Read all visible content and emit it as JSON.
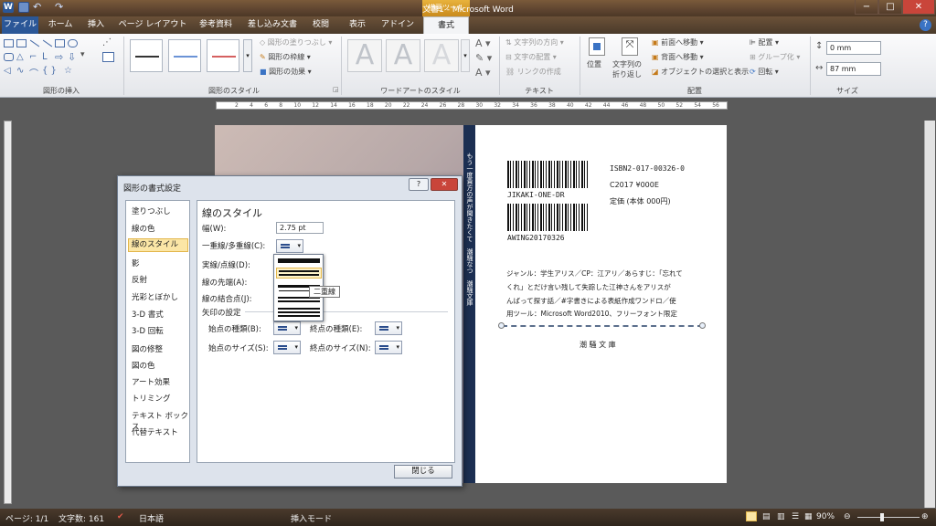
{
  "titlebar": {
    "title": "文書1 - Microsoft Word",
    "context_group": "描画ツール",
    "buttons": [
      "−",
      "□",
      "✕"
    ]
  },
  "tabs": [
    {
      "label": "ファイル"
    },
    {
      "label": "ホーム"
    },
    {
      "label": "挿入"
    },
    {
      "label": "ページ レイアウト"
    },
    {
      "label": "参考資料"
    },
    {
      "label": "差し込み文書"
    },
    {
      "label": "校閲"
    },
    {
      "label": "表示"
    },
    {
      "label": "アドイン"
    },
    {
      "label": "書式"
    }
  ],
  "ribbon": {
    "groups": {
      "insert_shapes": "図形の挿入",
      "shape_styles": "図形のスタイル",
      "wordart_styles": "ワードアートのスタイル",
      "text": "テキスト",
      "arrange": "配置",
      "size": "サイズ"
    },
    "shape_fill": "図形の塗りつぶし",
    "shape_outline": "図形の枠線",
    "shape_effects": "図形の効果",
    "text_direction": "文字列の方向",
    "text_align": "文字の配置",
    "create_link": "リンクの作成",
    "position": "位置",
    "wrap_text_1": "文字列の",
    "wrap_text_2": "折り返し",
    "bring_forward": "前面へ移動",
    "send_backward": "背面へ移動",
    "selection_pane": "オブジェクトの選択と表示",
    "align": "配置",
    "group": "グループ化",
    "rotate": "回転",
    "height": "0 mm",
    "width": "87 mm"
  },
  "ruler_ticks": [
    "2",
    "4",
    "6",
    "8",
    "10",
    "12",
    "14",
    "16",
    "18",
    "20",
    "22",
    "24",
    "26",
    "28",
    "30",
    "32",
    "34",
    "36",
    "38",
    "40",
    "42",
    "44",
    "46",
    "48",
    "50",
    "52",
    "54",
    "56"
  ],
  "document": {
    "isbn": "ISBN2-017-00326-0",
    "price_code": "C2017 ¥000E",
    "price": "定価 (本体 000円)",
    "barcode1_text": "JIKAKI-ONE-DR",
    "barcode2_text": "AWING20170326",
    "desc_line1": "ジャンル：学生アリス／CP：江アリ／あらすじ：「忘れて",
    "desc_line2": "くれ」とだけ言い残して失踪した江神さんをアリスが",
    "desc_line3": "んばって探す話／#字書きによる表紙作成ワンドロ／使",
    "desc_line4": "用ツール：Microsoft Word2010、フリーフォント限定",
    "publisher": "潮 騒 文 庫",
    "spine_text_1": "もう一度貴方の声が聞きたくて",
    "spine_text_2": "潮騒なつ",
    "spine_text_3": "潮騒文庫"
  },
  "dialog": {
    "title": "図形の書式設定",
    "nav": [
      "塗りつぶし",
      "線の色",
      "線のスタイル",
      "影",
      "反射",
      "光彩とぼかし",
      "3-D 書式",
      "3-D 回転",
      "図の修整",
      "図の色",
      "アート効果",
      "トリミング",
      "テキスト ボックス",
      "代替テキスト"
    ],
    "selected_index": 2,
    "section_title": "線のスタイル",
    "width_label": "幅(W):",
    "width_value": "2.75 pt",
    "compound_label": "一重線/多重線(C):",
    "dash_label": "実線/点線(D):",
    "cap_label": "線の先端(A):",
    "join_label": "線の結合点(J):",
    "arrow_section": "矢印の設定",
    "begin_type": "始点の種類(B):",
    "end_type": "終点の種類(E):",
    "begin_size": "始点のサイズ(S):",
    "end_size": "終点のサイズ(N):",
    "close": "閉じる",
    "tooltip": "二重線"
  },
  "statusbar": {
    "page": "ページ: 1/1",
    "words": "文字数: 161",
    "language": "日本語",
    "mode": "挿入モード",
    "zoom": "90%"
  }
}
